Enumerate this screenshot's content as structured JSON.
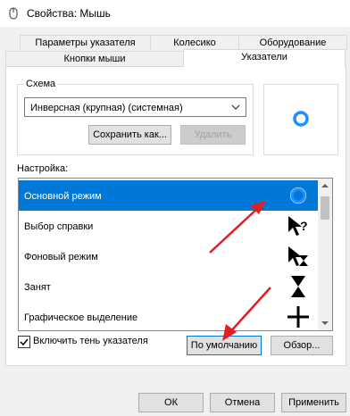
{
  "window": {
    "title": "Свойства: Мышь",
    "icon": "mouse-properties-icon"
  },
  "tabs": {
    "row1": [
      "Параметры указателя",
      "Колесико",
      "Оборудование"
    ],
    "row2": [
      "Кнопки мыши",
      "Указатели"
    ],
    "selected": "Указатели"
  },
  "scheme": {
    "group_label": "Схема",
    "selected": "Инверсная (крупная) (системная)",
    "save_label": "Сохранить как...",
    "delete_label": "Удалить"
  },
  "settings": {
    "label": "Настройка:",
    "items": [
      {
        "label": "Основной режим",
        "cursor": "busy-ring-icon",
        "selected": true
      },
      {
        "label": "Выбор справки",
        "cursor": "help-select-icon",
        "selected": false
      },
      {
        "label": "Фоновый режим",
        "cursor": "working-in-background-icon",
        "selected": false
      },
      {
        "label": "Занят",
        "cursor": "hourglass-icon",
        "selected": false
      },
      {
        "label": "Графическое выделение",
        "cursor": "precision-crosshair-icon",
        "selected": false
      }
    ]
  },
  "shadow": {
    "label": "Включить тень указателя",
    "checked": true
  },
  "buttons": {
    "default": "По умолчанию",
    "browse": "Обзор...",
    "ok": "ОК",
    "cancel": "Отмена",
    "apply": "Применить"
  },
  "colors": {
    "accent": "#0078d7",
    "annotation_arrow": "#e02020"
  }
}
